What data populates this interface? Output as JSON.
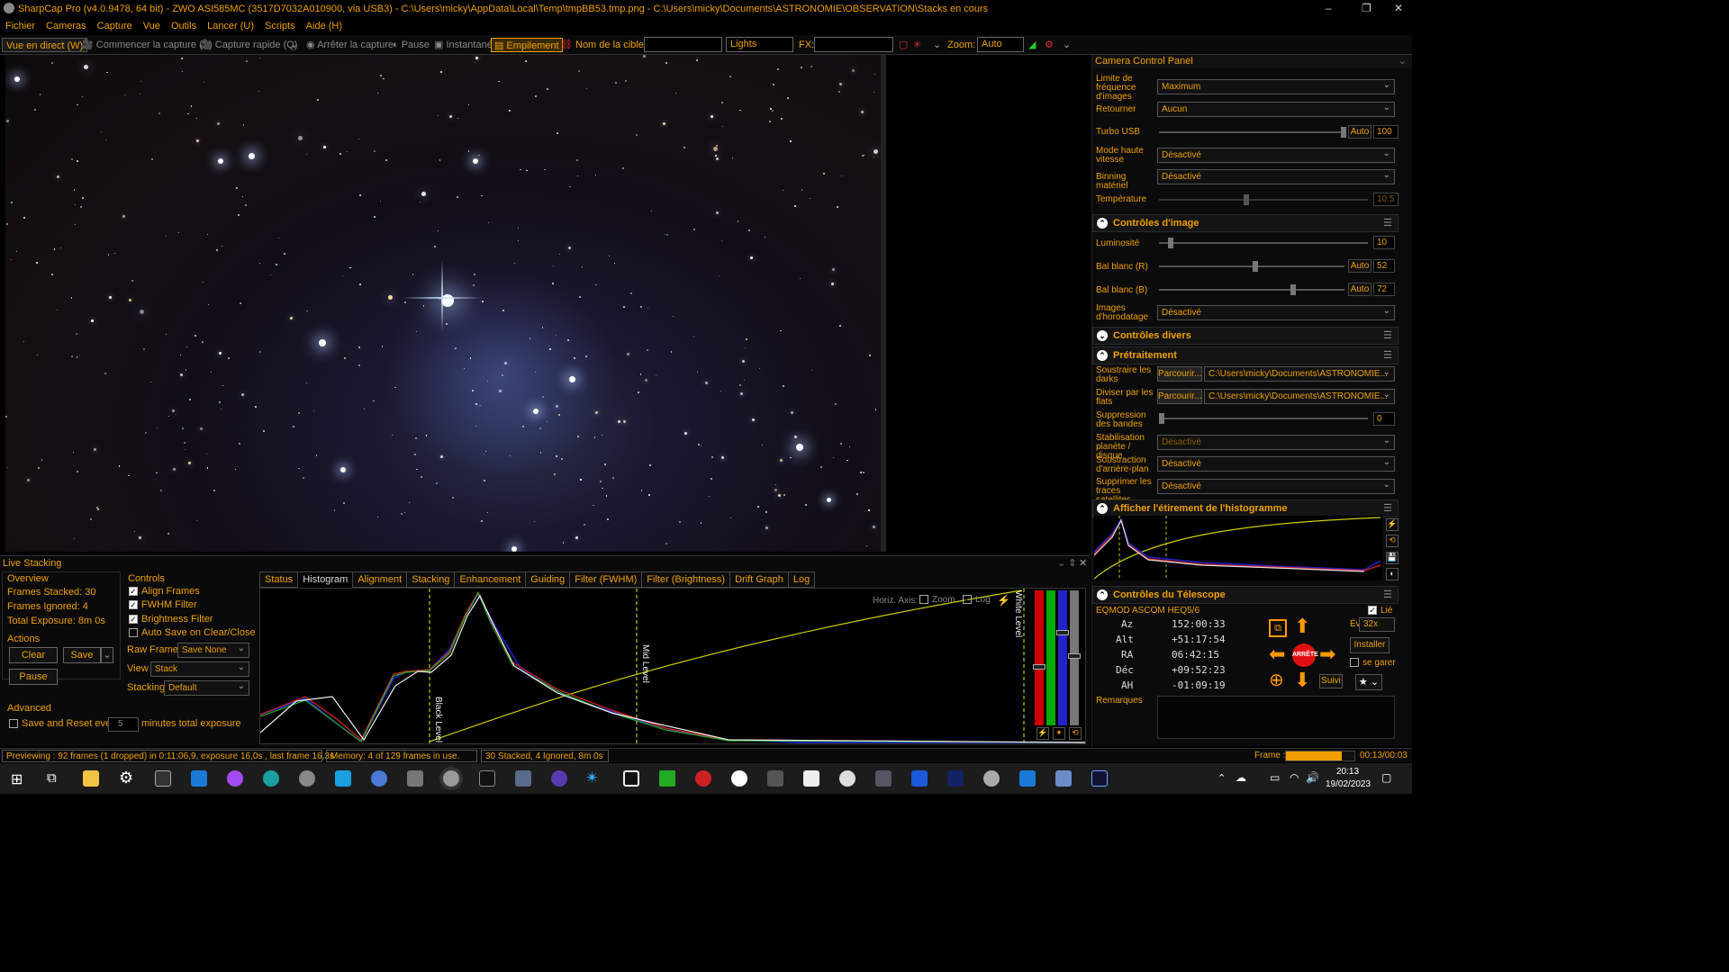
{
  "title": "SharpCap Pro (v4.0.9478, 64 bit) - ZWO ASI585MC (3517D7032A010900, via USB3) - C:\\Users\\micky\\AppData\\Local\\Temp\\tmpBB53.tmp.png - C:\\Users\\micky\\Documents\\ASTRONOMIE\\OBSERVATION\\Stacks en cours",
  "menu": [
    "Fichier",
    "Cameras",
    "Capture",
    "Vue",
    "Outils",
    "Lancer (U)",
    "Scripts",
    "Aide (H)"
  ],
  "toolbar": {
    "live_view": "Vue en direct (W)",
    "start_capture": "Commencer la capture (S)",
    "quick_capture": "Capture rapide (Q)",
    "stop_capture": "Arrêter la capture",
    "pause": "Pause",
    "snapshot": "Instantané",
    "stack": "Empilement",
    "target_label": "Nom de la cible:",
    "target_value": "",
    "frame_type": "Lights",
    "fx_label": "FX:",
    "zoom_label": "Zoom:",
    "zoom_value": "Auto"
  },
  "camera_panel": {
    "title": "Camera Control Panel",
    "rows": [
      {
        "label": "Limite de fréquence d'images",
        "value": "Maximum"
      },
      {
        "label": "Retourner",
        "value": "Aucun"
      },
      {
        "label": "Turbo USB",
        "auto": "Auto",
        "num": "100"
      },
      {
        "label": "Mode haute vitesse",
        "value": "Désactivé"
      },
      {
        "label": "Binning matériel",
        "value": "Désactivé"
      },
      {
        "label": "Température",
        "num": "10.5"
      }
    ],
    "image_controls": {
      "title": "Contrôles d'image",
      "luminosity_label": "Luminosité",
      "luminosity": "10",
      "wb_r_label": "Bal blanc (R)",
      "wb_r_auto": "Auto",
      "wb_r": "52",
      "wb_b_label": "Bal blanc (B)",
      "wb_b_auto": "Auto",
      "wb_b": "72",
      "timestamp_label": "Images d'horodatage",
      "timestamp": "Désactivé"
    },
    "misc_title": "Contrôles divers",
    "preprocessing": {
      "title": "Prétraitement",
      "darks_label": "Soustraire les darks",
      "browse": "Parcourir...",
      "darks_path": "C:\\Users\\micky\\Documents\\ASTRONOMIE...",
      "flats_label": "Diviser par les flats",
      "flats_path": "C:\\Users\\micky\\Documents\\ASTRONOMIE...",
      "banding_label": "Suppression des bandes",
      "banding": "0",
      "stab_label": "Stabilisation planète / disque",
      "stab": "Désactivé",
      "bg_label": "Soustraction d'arrière-plan",
      "bg": "Désactivé",
      "sat_label": "Supprimer les traces satellites",
      "sat": "Désactivé"
    },
    "histogram_title": "Afficher l'étirement de l'histogramme",
    "telescope": {
      "title": "Contrôles du Télescope",
      "linked": "Lié",
      "mount": "EQMOD ASCOM HEQ5/6",
      "az_label": "Az",
      "az": "152:00:33",
      "alt_label": "Alt",
      "alt": "+51:17:54",
      "ra_label": "RA",
      "ra": "06:42:15",
      "dec_label": "Déc",
      "dec": "+09:52:23",
      "ah_label": "AH",
      "ah": "-01:09:19",
      "rate_label": "Évaluer:",
      "rate": "32x",
      "setup": "Installer",
      "stop": "ARRÊTE",
      "park": "se garer",
      "track": "Suivi",
      "notes": "Remarques"
    }
  },
  "live_stacking": {
    "title": "Live Stacking",
    "overview": "Overview",
    "frames_stacked": "Frames Stacked: 30",
    "frames_ignored": "Frames Ignored: 4",
    "total_exposure": "Total Exposure:  8m 0s",
    "actions": "Actions",
    "clear": "Clear",
    "save": "Save",
    "pause": "Pause",
    "advanced": "Advanced",
    "save_reset": "Save and Reset every",
    "save_reset_value": "5",
    "save_reset_unit": "minutes total exposure",
    "controls": "Controls",
    "align": "Align Frames",
    "fwhm": "FWHM Filter",
    "brightness": "Brightness Filter",
    "autosave": "Auto Save on Clear/Close",
    "raw_label": "Raw Frames",
    "raw_value": "Save None",
    "view_label": "View",
    "view_value": "Stack",
    "stacking_label": "Stacking",
    "stacking_value": "Default",
    "tabs": [
      "Status",
      "Histogram",
      "Alignment",
      "Stacking",
      "Enhancement",
      "Guiding",
      "Filter (FWHM)",
      "Filter (Brightness)",
      "Drift Graph",
      "Log"
    ],
    "hist_axis": "Horiz. Axis:",
    "hist_zoom": "Zoom",
    "hist_log": "Log",
    "black_level": "Black Level",
    "mid_level": "Mid Level",
    "white_level": "White Level"
  },
  "status": {
    "preview": "Previewing : 92 frames (1 dropped) in 0:11:06,9, exposure 16,0s , last frame 16,3s",
    "memory": "Memory: 4 of 129 frames in use.",
    "stacked": "30 Stacked, 4 Ignored, 8m 0s",
    "frame_label": "Frame :",
    "frame_time": "00:13/00:03"
  },
  "clock": {
    "time": "20:13",
    "date": "19/02/2023"
  },
  "colors": {
    "accent": "#f0a000",
    "background": "#000000"
  }
}
